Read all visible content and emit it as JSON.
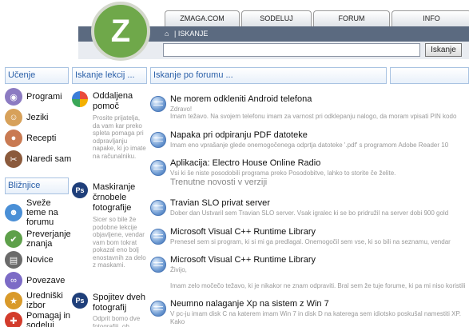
{
  "logo": {
    "letter": "Z"
  },
  "tabs": [
    "ZMAGA.COM",
    "SODELUJ",
    "FORUM",
    "INFO"
  ],
  "breadcrumb": {
    "home_icon": "⌂",
    "label": "ISKANJE"
  },
  "search": {
    "value": "",
    "placeholder": "",
    "button": "Iskanje"
  },
  "columns": {
    "learning": "Učenje",
    "lessons": "Iskanje lekcij ...",
    "forum": "Iskanje po forumu ...",
    "extra": ""
  },
  "sidebar": {
    "learning_items": [
      "Programi",
      "Jeziki",
      "Recepti",
      "Naredi sam"
    ],
    "nearby_head": "Bližnjice",
    "nearby_items": [
      "Sveže teme na forumu",
      "Preverjanje znanja",
      "Novice",
      "Povezave",
      "Uredniški izbor",
      "Pomagaj in sodeluj"
    ]
  },
  "lessons": [
    {
      "title": "Oddaljena pomoč",
      "desc": "Prosite prijatelja, da vam kar preko spleta pomaga pri odpravljanju napake, ki jo imate na računalniku."
    },
    {
      "title": "Maskiranje črnobele fotografije",
      "desc": "Sicer so bile že podobne lekcije objavljene, vendar vam bom tokrat pokazal eno bolj enostavnih za delo z maskami."
    },
    {
      "title": "Spojitev dveh fotografij",
      "desc": "Odprit bomo dve fotografiji, ob"
    }
  ],
  "forum_posts": [
    {
      "title": "Ne morem odkleniti Android telefona",
      "desc": "Zdravo!",
      "extra": "Imam težavo. Na svojem telefonu imam za varnost pri odklepanju nalogo, da moram vpisati PIN kodo"
    },
    {
      "title": "Napaka pri odpiranju PDF datoteke",
      "desc": "Imam eno vprašanje glede onemogočenega odprtja datoteke '.pdf' s programom Adobe Reader 10",
      "extra": ""
    },
    {
      "title": "Aplikacija: Electro House Online Radio",
      "desc": "Vsi ki še niste posodobili programa preko Posodobitve, lahko to storite če želite.",
      "extra": "Trenutne novosti v verziji"
    },
    {
      "title": "Travian SLO privat server",
      "desc": "Dober dan Ustvaril sem Travian SLO server. Vsak igralec ki se bo pridružil na server dobi 900 gold",
      "extra": ""
    },
    {
      "title": "Microsoft Visual C++ Runtime Library",
      "desc": "Prenesel sem si program, ki si mi ga predlagal. Onemogočil sem vse, ki so bili na seznamu, vendar",
      "extra": ""
    },
    {
      "title": "Microsoft Visual C++ Runtime Library",
      "desc": "Živijo,",
      "extra": "Imam zelo močečo težavo, ki je nikakor ne znam odpraviti. Bral sem že tuje forume, ki pa mi niso koristili"
    },
    {
      "title": "Neumno nalaganje Xp na sistem z Win 7",
      "desc": "V pc-ju imam disk C na katerem imam Win 7 in disk D na katerega sem idiotsko poskušal namestiti XP.",
      "extra": "Kako"
    }
  ]
}
